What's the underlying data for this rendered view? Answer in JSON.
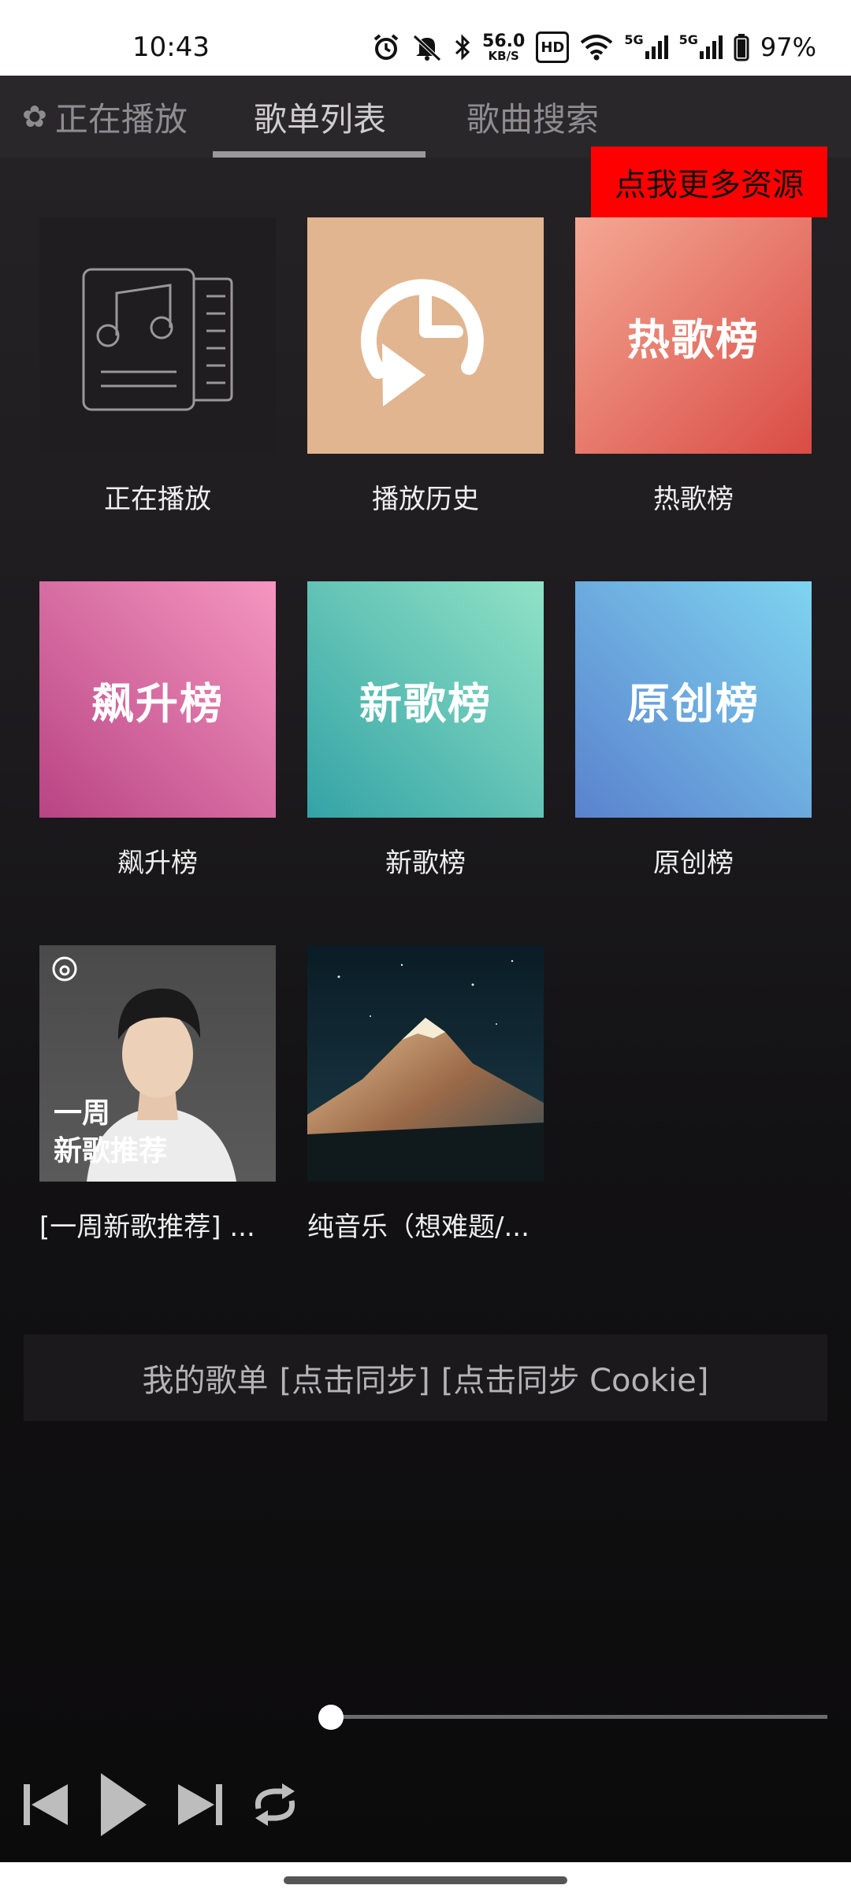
{
  "status_bar": {
    "time": "10:43",
    "net_speed_value": "56.0",
    "net_speed_unit": "KB/S",
    "hd_label": "HD",
    "sim1_label": "5G",
    "sim2_label": "5G",
    "battery": "97%",
    "icons": [
      "alarm-icon",
      "mute-icon",
      "bluetooth-icon",
      "wifi-icon",
      "signal-icon",
      "battery-icon"
    ]
  },
  "tabs": [
    {
      "label": "正在播放",
      "icon": "flower-icon"
    },
    {
      "label": "歌单列表",
      "active": true
    },
    {
      "label": "歌曲搜索"
    }
  ],
  "more_button": "点我更多资源",
  "playlists": [
    {
      "title": "正在播放",
      "cover_text": "",
      "icon": "music-document-icon",
      "bg": "#1f1d20"
    },
    {
      "title": "播放历史",
      "cover_text": "",
      "icon": "history-clock-icon",
      "bg": "#e1b590"
    },
    {
      "title": "热歌榜",
      "cover_text": "热歌榜",
      "bg_from": "#f19a85",
      "bg_to": "#d94c45"
    },
    {
      "title": "飙升榜",
      "cover_text": "飙升榜",
      "bg_from": "#f48fbe",
      "bg_to": "#b94484"
    },
    {
      "title": "新歌榜",
      "cover_text": "新歌榜",
      "bg_from": "#8ee0c4",
      "bg_to": "#36a8a8"
    },
    {
      "title": "原创榜",
      "cover_text": "原创榜",
      "bg_from": "#7cd2ef",
      "bg_to": "#5a86cf"
    },
    {
      "title": "[一周新歌推荐] ...",
      "cover_text_line1": "一周",
      "cover_text_line2": "新歌推荐",
      "icon": "netease-logo-icon"
    },
    {
      "title": "纯音乐（想难题/...",
      "cover_text": "",
      "icon": "mountain-night-cover"
    }
  ],
  "my_playlists": {
    "label": "我的歌单",
    "sync_link": "[点击同步]",
    "sync_cookie_link": "[点击同步 Cookie]"
  },
  "player": {
    "icons": [
      "previous-icon",
      "play-icon",
      "next-icon",
      "repeat-icon"
    ],
    "progress": 0
  },
  "colors": {
    "accent_red": "#ff0000",
    "tab_bg": "#2a272b"
  }
}
